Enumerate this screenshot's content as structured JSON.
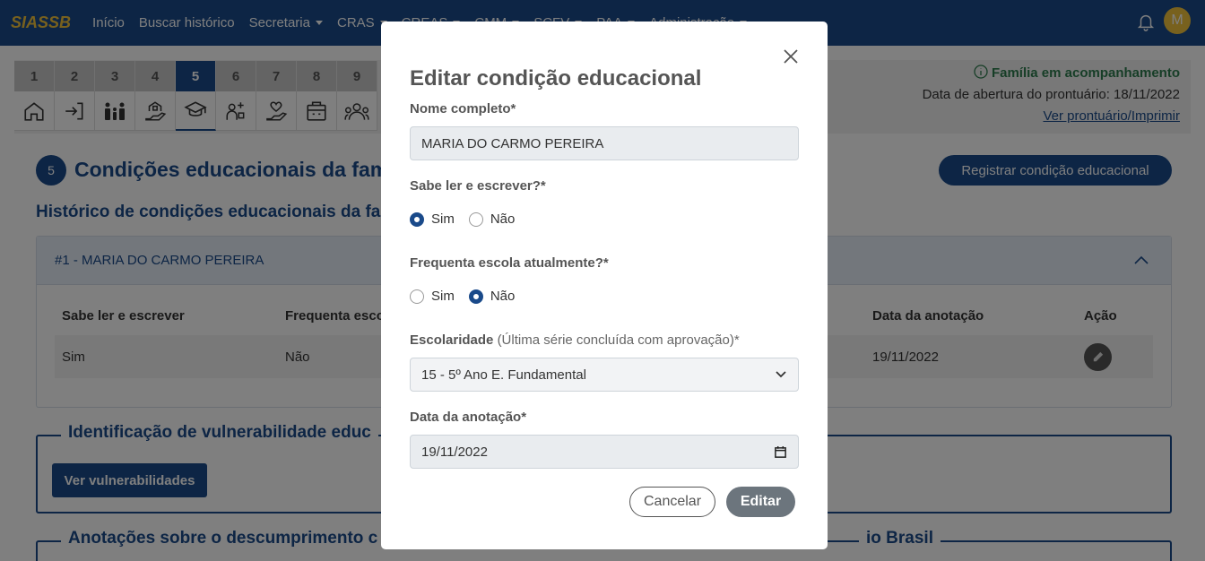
{
  "navbar": {
    "brand": "SIASSB",
    "items": [
      {
        "label": "Início",
        "dropdown": false
      },
      {
        "label": "Buscar histórico",
        "dropdown": false
      },
      {
        "label": "Secretaria",
        "dropdown": true
      },
      {
        "label": "CRAS",
        "dropdown": true
      },
      {
        "label": "CREAS",
        "dropdown": true
      },
      {
        "label": "CMM",
        "dropdown": true
      },
      {
        "label": "SCFV",
        "dropdown": true
      },
      {
        "label": "PAA",
        "dropdown": true
      },
      {
        "label": "Administração",
        "dropdown": true
      }
    ],
    "avatar_letter": "M"
  },
  "steps": [
    {
      "num": "1",
      "icon": "home-icon"
    },
    {
      "num": "2",
      "icon": "login-icon"
    },
    {
      "num": "3",
      "icon": "family-icon"
    },
    {
      "num": "4",
      "icon": "housing-icon"
    },
    {
      "num": "5",
      "icon": "graduation-cap-icon",
      "active": true
    },
    {
      "num": "6",
      "icon": "health-icon"
    },
    {
      "num": "7",
      "icon": "care-hand-icon"
    },
    {
      "num": "8",
      "icon": "calendar-briefcase-icon"
    },
    {
      "num": "9",
      "icon": "community-icon"
    }
  ],
  "status": {
    "family_status": "Família em acompanhamento",
    "opening_date": "Data de abertura do prontuário: 18/11/2022",
    "link": "Ver prontuário/Imprimir"
  },
  "section": {
    "number": "5",
    "title": "Condições educacionais da fam",
    "register_button": "Registrar condição educacional",
    "history_title": "Histórico de condições educacionais da fa"
  },
  "accordion": {
    "title": "#1 - MARIA DO CARMO PEREIRA",
    "columns": [
      "Sabe ler e escrever",
      "Frequenta esco",
      "Data da anotação",
      "Ação"
    ],
    "row": [
      "Sim",
      "Não",
      "19/11/2022"
    ]
  },
  "vulnerability": {
    "legend": "Identificação de vulnerabilidade educ",
    "button": "Ver vulnerabilidades"
  },
  "notes": {
    "legend_start": "Anotações sobre o descumprimento c",
    "legend_end": "io Brasil"
  },
  "modal": {
    "title": "Editar condição educacional",
    "name_label": "Nome completo*",
    "name_value": "MARIA DO CARMO PEREIRA",
    "literacy_label": "Sabe ler e escrever?*",
    "literacy_options": [
      "Sim",
      "Não"
    ],
    "literacy_selected": "Sim",
    "school_label": "Frequenta escola atualmente?*",
    "school_options": [
      "Sim",
      "Não"
    ],
    "school_selected": "Não",
    "education_label": "Escolaridade",
    "education_hint": "(Última série concluída com aprovação)*",
    "education_value": "15 - 5º Ano E. Fundamental",
    "date_label": "Data da anotação*",
    "date_value": "19/11/2022",
    "cancel_button": "Cancelar",
    "edit_button": "Editar"
  }
}
